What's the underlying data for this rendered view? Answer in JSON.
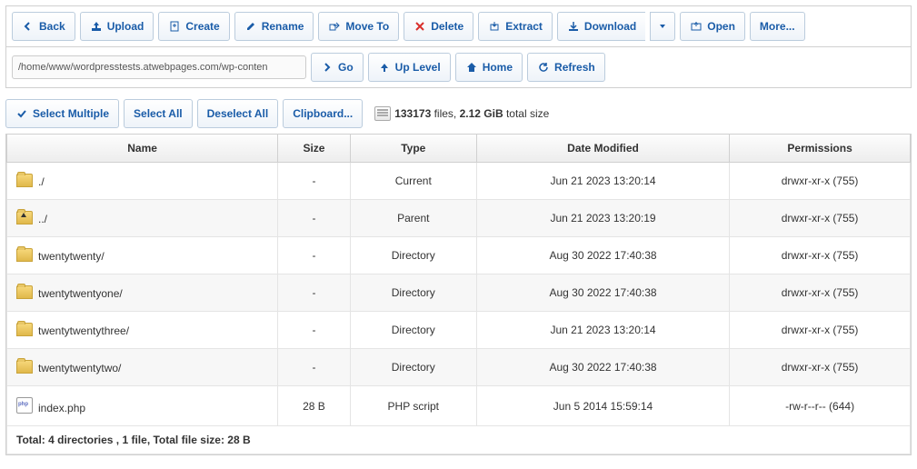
{
  "toolbar": {
    "back": "Back",
    "upload": "Upload",
    "create": "Create",
    "rename": "Rename",
    "move": "Move To",
    "delete": "Delete",
    "extract": "Extract",
    "download": "Download",
    "open": "Open",
    "more": "More..."
  },
  "nav": {
    "path": "/home/www/wordpresstests.atwebpages.com/wp-conten",
    "go": "Go",
    "up": "Up Level",
    "home": "Home",
    "refresh": "Refresh"
  },
  "sel": {
    "multi": "Select Multiple",
    "all": "Select All",
    "none": "Deselect All",
    "clip": "Clipboard..."
  },
  "stats": {
    "count": "133173",
    "mid": " files, ",
    "size": "2.12 GiB",
    "tail": " total size"
  },
  "cols": {
    "name": "Name",
    "size": "Size",
    "type": "Type",
    "date": "Date Modified",
    "perm": "Permissions"
  },
  "rows": [
    {
      "name": "./",
      "size": "-",
      "type": "Current",
      "date": "Jun 21 2023 13:20:14",
      "perm": "drwxr-xr-x (755)",
      "icon": "folder"
    },
    {
      "name": "../",
      "size": "-",
      "type": "Parent",
      "date": "Jun 21 2023 13:20:19",
      "perm": "drwxr-xr-x (755)",
      "icon": "folder-up"
    },
    {
      "name": "twentytwenty/",
      "size": "-",
      "type": "Directory",
      "date": "Aug 30 2022 17:40:38",
      "perm": "drwxr-xr-x (755)",
      "icon": "folder"
    },
    {
      "name": "twentytwentyone/",
      "size": "-",
      "type": "Directory",
      "date": "Aug 30 2022 17:40:38",
      "perm": "drwxr-xr-x (755)",
      "icon": "folder"
    },
    {
      "name": "twentytwentythree/",
      "size": "-",
      "type": "Directory",
      "date": "Jun 21 2023 13:20:14",
      "perm": "drwxr-xr-x (755)",
      "icon": "folder"
    },
    {
      "name": "twentytwentytwo/",
      "size": "-",
      "type": "Directory",
      "date": "Aug 30 2022 17:40:38",
      "perm": "drwxr-xr-x (755)",
      "icon": "folder"
    },
    {
      "name": "index.php",
      "size": "28 B",
      "type": "PHP script",
      "date": "Jun 5 2014 15:59:14",
      "perm": "-rw-r--r-- (644)",
      "icon": "php"
    }
  ],
  "summary": "Total: 4 directories , 1 file, Total file size: 28 B"
}
